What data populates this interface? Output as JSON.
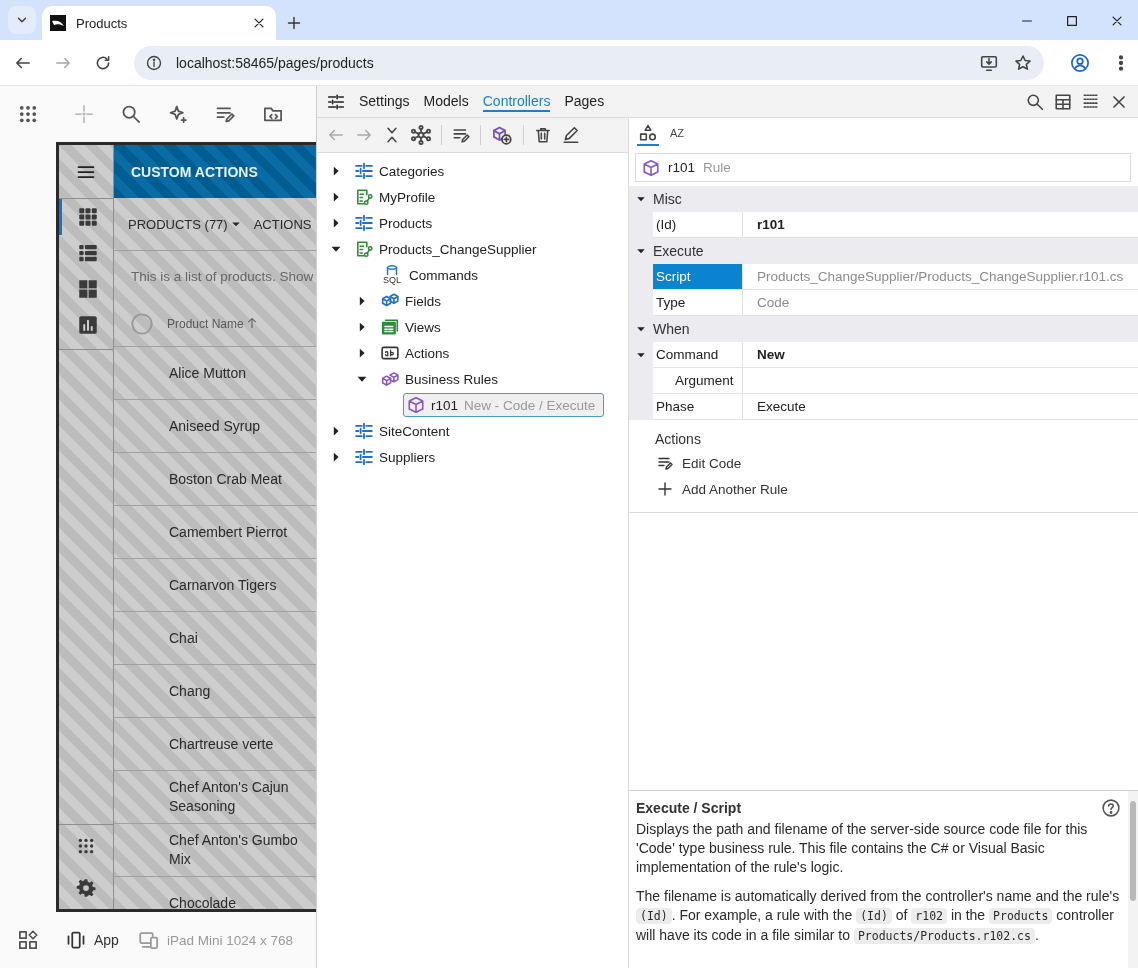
{
  "browser": {
    "tab_title": "Products",
    "url": "localhost:58465/pages/products"
  },
  "app": {
    "title": "CUSTOM ACTIONS",
    "rail": [
      {
        "kind": "grid",
        "selected": true
      },
      {
        "kind": "list",
        "selected": false
      },
      {
        "kind": "tiles",
        "selected": false
      },
      {
        "kind": "chart",
        "selected": false
      }
    ],
    "menu": [
      {
        "label": "PRODUCTS (77)",
        "dropdown": true
      },
      {
        "label": "ACTIONS",
        "dropdown": false
      }
    ],
    "description": "This is a list of products. Show",
    "column": "Product Name",
    "rows": [
      "Alice Mutton",
      "Aniseed Syrup",
      "Boston Crab Meat",
      "Camembert Pierrot",
      "Carnarvon Tigers",
      "Chai",
      "Chang",
      "Chartreuse verte",
      "Chef Anton's Cajun Seasoning",
      "Chef Anton's Gumbo Mix",
      "Chocolade"
    ]
  },
  "device_bar": {
    "mode": "App",
    "device": "iPad Mini 1024 x 768"
  },
  "designer": {
    "tabs": [
      {
        "label": "Settings",
        "selected": false
      },
      {
        "label": "Models",
        "selected": false
      },
      {
        "label": "Controllers",
        "selected": true
      },
      {
        "label": "Pages",
        "selected": false
      }
    ],
    "tree": [
      {
        "label": "Categories",
        "kind": "controller",
        "expanded": false,
        "selected": false
      },
      {
        "label": "MyProfile",
        "kind": "flow",
        "expanded": false,
        "selected": false
      },
      {
        "label": "Products",
        "kind": "controller",
        "expanded": false,
        "selected": false
      },
      {
        "label": "Products_ChangeSupplier",
        "kind": "flow",
        "expanded": true,
        "selected": false,
        "children": [
          {
            "label": "Commands",
            "kind": "sql",
            "icon_text": "SQL",
            "selected": false
          },
          {
            "label": "Fields",
            "kind": "fields",
            "expanded": false,
            "selected": false
          },
          {
            "label": "Views",
            "kind": "views",
            "expanded": false,
            "selected": false
          },
          {
            "label": "Actions",
            "kind": "actions",
            "expanded": false,
            "selected": false
          },
          {
            "label": "Business Rules",
            "kind": "rules",
            "expanded": true,
            "selected": false,
            "children": [
              {
                "label": "r101",
                "detail": "New - Code / Execute",
                "kind": "rule",
                "selected": true
              }
            ]
          }
        ]
      },
      {
        "label": "SiteContent",
        "kind": "controller",
        "expanded": false,
        "selected": false
      },
      {
        "label": "Suppliers",
        "kind": "controller",
        "expanded": false,
        "selected": false
      }
    ],
    "inspector": {
      "views": [
        {
          "kind": "categorized",
          "selected": true
        },
        {
          "kind": "alphabetical",
          "label": "AZ",
          "selected": false
        }
      ],
      "object": {
        "name": "r101",
        "type": "Rule"
      },
      "categories": [
        {
          "name": "Misc",
          "expanded": true,
          "properties": [
            {
              "name": "(Id)",
              "value": "r101",
              "modified": true,
              "read_only": false,
              "selected": false
            }
          ]
        },
        {
          "name": "Execute",
          "expanded": true,
          "properties": [
            {
              "name": "Script",
              "value": "Products_ChangeSupplier/Products_ChangeSupplier.r101.cs",
              "modified": false,
              "read_only": true,
              "selected": true
            },
            {
              "name": "Type",
              "value": "Code",
              "modified": false,
              "read_only": true,
              "selected": false
            }
          ]
        },
        {
          "name": "When",
          "expanded": true,
          "properties": [
            {
              "name": "Command",
              "value": "New",
              "modified": true,
              "read_only": false,
              "selected": false,
              "expanded": true,
              "children": [
                {
                  "name": "Argument",
                  "selected": false
                }
              ]
            },
            {
              "name": "Phase",
              "value": "Execute",
              "modified": false,
              "read_only": false,
              "selected": false
            }
          ]
        }
      ],
      "actions_title": "Actions",
      "actions": [
        {
          "label": "Edit Code",
          "kind": "edit"
        },
        {
          "label": "Add Another Rule",
          "kind": "add"
        }
      ]
    },
    "help": {
      "title": "Execute / Script",
      "paragraphs": [
        [
          {
            "text": "Displays the path and filename of the server-side source code file for this 'Code' type business rule. This file contains the C# or Visual Basic implementation of the rule's logic."
          }
        ],
        [
          {
            "text": "The filename is automatically derived from the controller's name and the rule's "
          },
          {
            "text": "(Id)",
            "code": true
          },
          {
            "text": ". For example, a rule with the "
          },
          {
            "text": "(Id)",
            "code": true
          },
          {
            "text": " of "
          },
          {
            "text": "r102",
            "code": true
          },
          {
            "text": " in the "
          },
          {
            "text": "Products",
            "code": true
          },
          {
            "text": " controller will have its code in a file similar to "
          },
          {
            "text": "Products/Products.r102.cs",
            "code": true
          },
          {
            "text": "."
          }
        ]
      ]
    }
  }
}
